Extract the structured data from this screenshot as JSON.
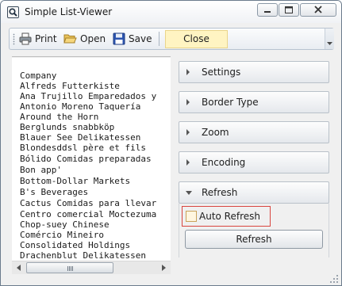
{
  "window": {
    "title": "Simple List-Viewer"
  },
  "toolbar": {
    "print_label": "Print",
    "open_label": "Open",
    "save_label": "Save",
    "close_label": "Close"
  },
  "list": {
    "items": [
      "Company",
      "Alfreds Futterkiste",
      "Ana Trujillo Emparedados y",
      "Antonio Moreno Taquería",
      "Around the Horn",
      "Berglunds snabbköp",
      "Blauer See Delikatessen",
      "Blondesddsl père et fils",
      "Bólido Comidas preparadas",
      "Bon app'",
      "Bottom-Dollar Markets",
      "B's Beverages",
      "Cactus Comidas para llevar",
      "Centro comercial Moctezuma",
      "Chop-suey Chinese",
      "Comércio Mineiro",
      "Consolidated Holdings",
      "Drachenblut Delikatessen"
    ]
  },
  "panels": [
    {
      "label": "Settings",
      "expanded": false
    },
    {
      "label": "Border Type",
      "expanded": false
    },
    {
      "label": "Zoom",
      "expanded": false
    },
    {
      "label": "Encoding",
      "expanded": false
    },
    {
      "label": "Refresh",
      "expanded": true
    }
  ],
  "refresh": {
    "auto_refresh_label": "Auto Refresh",
    "auto_refresh_checked": false,
    "refresh_button_label": "Refresh"
  },
  "colors": {
    "close_highlight": "#fff4c2",
    "focus_border": "#d9453f"
  }
}
